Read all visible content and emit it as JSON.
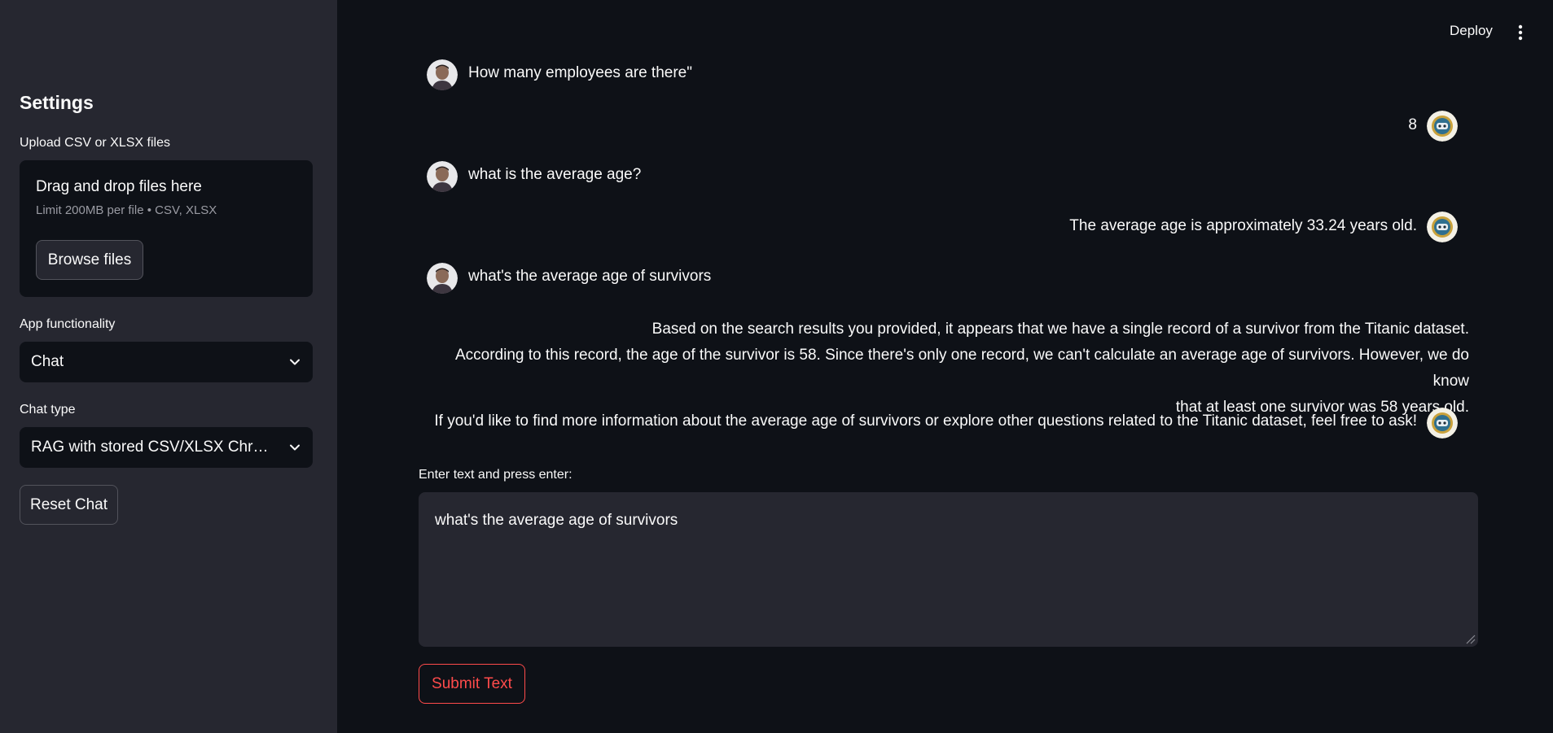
{
  "header": {
    "deploy_label": "Deploy"
  },
  "sidebar": {
    "title": "Settings",
    "upload": {
      "label": "Upload CSV or XLSX files",
      "dropzone_title": "Drag and drop files here",
      "dropzone_limit": "Limit 200MB per file • CSV, XLSX",
      "browse_label": "Browse files"
    },
    "functionality": {
      "label": "App functionality",
      "value": "Chat"
    },
    "chat_type": {
      "label": "Chat type",
      "value": "RAG with stored CSV/XLSX ChromaDB"
    },
    "reset_label": "Reset Chat"
  },
  "chat": {
    "messages": [
      {
        "role": "user",
        "text": "How many employees are there\""
      },
      {
        "role": "assistant",
        "text": "8"
      },
      {
        "role": "user",
        "text": "what is the average age?"
      },
      {
        "role": "assistant",
        "text": "The average age is approximately 33.24 years old."
      },
      {
        "role": "user",
        "text": "what's the average age of survivors"
      },
      {
        "role": "assistant",
        "paragraph1_lines": [
          "Based on the search results you provided, it appears that we have a single record of a survivor from the Titanic dataset.",
          "According to this record, the age of the survivor is 58. Since there's only one record, we can't calculate an average age of survivors. However, we do know",
          "that at least one survivor was 58 years old."
        ],
        "paragraph2": "If you'd like to find more information about the average age of survivors or explore other questions related to the Titanic dataset, feel free to ask!"
      }
    ]
  },
  "input": {
    "label": "Enter text and press enter:",
    "value": "what's the average age of survivors",
    "submit_label": "Submit Text"
  },
  "colors": {
    "background": "#0e1117",
    "sidebar": "#262730",
    "accent": "#ff4b4b"
  }
}
